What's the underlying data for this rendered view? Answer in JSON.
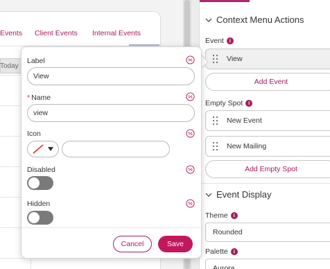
{
  "background": {
    "tabs": [
      {
        "label": "Events"
      },
      {
        "label": "Client Events"
      },
      {
        "label": "Internal Events"
      }
    ],
    "today_label": "Today"
  },
  "popover": {
    "label_field": {
      "label": "Label",
      "value": "View"
    },
    "name_field": {
      "required_mark": "*",
      "label": "Name",
      "value": "view"
    },
    "icon_field": {
      "label": "Icon",
      "value": ""
    },
    "disabled_field": {
      "label": "Disabled",
      "value": false
    },
    "hidden_field": {
      "label": "Hidden",
      "value": false
    },
    "cancel_label": "Cancel",
    "save_label": "Save"
  },
  "panel": {
    "context_menu": {
      "title": "Context Menu Actions",
      "event_label": "Event",
      "events": [
        {
          "label": "View"
        }
      ],
      "add_event_label": "Add Event",
      "empty_spot_label": "Empty Spot",
      "empty_spot_items": [
        {
          "label": "New Event"
        },
        {
          "label": "New Mailing"
        }
      ],
      "add_empty_spot_label": "Add Empty Spot"
    },
    "event_display": {
      "title": "Event Display",
      "theme_label": "Theme",
      "theme_value": "Rounded",
      "palette_label": "Palette",
      "palette_value": "Aurora"
    }
  },
  "colors": {
    "accent": "#a61c5e",
    "save_bg": "#c2185b",
    "toggle_off": "#7a7a7a"
  }
}
